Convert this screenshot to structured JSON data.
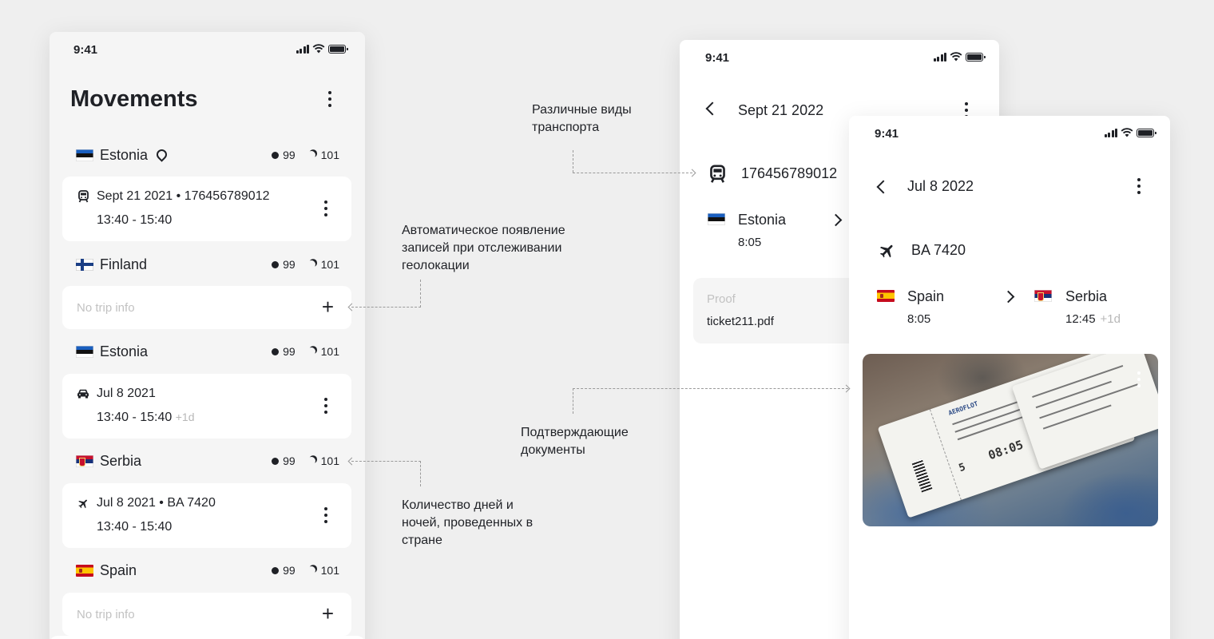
{
  "colors": {
    "background": "#efefef",
    "text": "#1f2126",
    "muted": "#c2c2c2",
    "card": "#ffffff"
  },
  "movements_screen": {
    "status_time": "9:41",
    "title": "Movements",
    "entries": [
      {
        "country": "Estonia",
        "flag": "ee",
        "geolocated": true,
        "days": "99",
        "nights": "101",
        "trip": {
          "transport_icon": "train-icon",
          "line1_date": "Sept 21 2021",
          "line1_sep": " • ",
          "line1_ref": "176456789012",
          "time": "13:40 - 15:40",
          "plus_days": ""
        }
      },
      {
        "country": "Finland",
        "flag": "fi",
        "geolocated": false,
        "days": "99",
        "nights": "101",
        "trip": null,
        "empty_placeholder": "No trip info"
      },
      {
        "country": "Estonia",
        "flag": "ee",
        "geolocated": false,
        "days": "99",
        "nights": "101",
        "trip": {
          "transport_icon": "car-icon",
          "line1_date": "Jul 8 2021",
          "line1_sep": "",
          "line1_ref": "",
          "time": "13:40 - 15:40",
          "plus_days": "+1d"
        }
      },
      {
        "country": "Serbia",
        "flag": "rs",
        "geolocated": false,
        "days": "99",
        "nights": "101",
        "trip": {
          "transport_icon": "plane-icon",
          "line1_date": "Jul 8 2021",
          "line1_sep": " • ",
          "line1_ref": "BA 7420",
          "time": "13:40 - 15:40",
          "plus_days": ""
        }
      },
      {
        "country": "Spain",
        "flag": "es",
        "geolocated": false,
        "days": "99",
        "nights": "101",
        "trip": null,
        "empty_placeholder": "No trip info"
      }
    ]
  },
  "train_detail_screen": {
    "status_time": "9:41",
    "date": "Sept 21 2022",
    "transport_icon": "train-icon",
    "ticket_number": "176456789012",
    "from_country": "Estonia",
    "from_time": "8:05",
    "proof_label": "Proof",
    "proof_file": "ticket211.pdf"
  },
  "flight_detail_screen": {
    "status_time": "9:41",
    "date": "Jul 8 2022",
    "transport_icon": "plane-icon",
    "flight_number": "BA 7420",
    "from_country": "Spain",
    "from_time": "8:05",
    "to_country": "Serbia",
    "to_time": "12:45",
    "to_plus_days": "+1d",
    "ticket_photo": {
      "brand": "AEROFLOT",
      "boarding_time": "08:05",
      "gate": "5"
    }
  },
  "annotations": {
    "transport": "Различные виды транспорта",
    "geolocation": "Автоматическое появление записей при отслеживании геолокации",
    "documents": "Подтверждающие документы",
    "days_nights": "Количество дней и ночей, проведенных в стране"
  }
}
